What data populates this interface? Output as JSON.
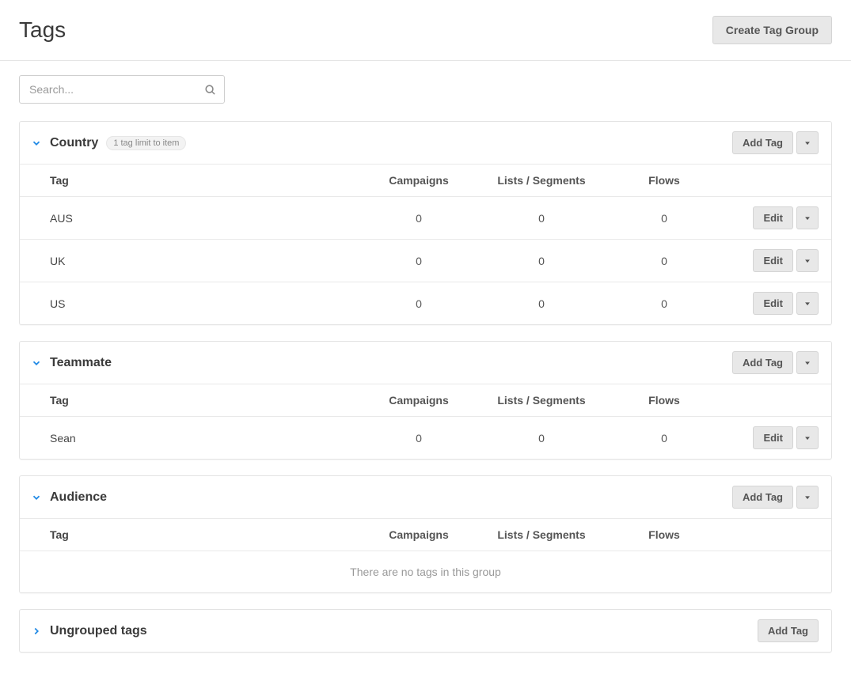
{
  "header": {
    "title": "Tags",
    "create_group_label": "Create Tag Group"
  },
  "search": {
    "placeholder": "Search..."
  },
  "columns": {
    "tag": "Tag",
    "campaigns": "Campaigns",
    "lists_segments": "Lists / Segments",
    "flows": "Flows"
  },
  "buttons": {
    "add_tag": "Add Tag",
    "edit": "Edit"
  },
  "groups": [
    {
      "name": "Country",
      "expanded": true,
      "limit_label": "1 tag limit to item",
      "has_dropdown": true,
      "tags": [
        {
          "name": "AUS",
          "campaigns": 0,
          "lists_segments": 0,
          "flows": 0
        },
        {
          "name": "UK",
          "campaigns": 0,
          "lists_segments": 0,
          "flows": 0
        },
        {
          "name": "US",
          "campaigns": 0,
          "lists_segments": 0,
          "flows": 0
        }
      ]
    },
    {
      "name": "Teammate",
      "expanded": true,
      "has_dropdown": true,
      "tags": [
        {
          "name": "Sean",
          "campaigns": 0,
          "lists_segments": 0,
          "flows": 0
        }
      ]
    },
    {
      "name": "Audience",
      "expanded": true,
      "has_dropdown": true,
      "tags": [],
      "empty_message": "There are no tags in this group"
    },
    {
      "name": "Ungrouped tags",
      "expanded": false,
      "has_dropdown": false
    }
  ]
}
